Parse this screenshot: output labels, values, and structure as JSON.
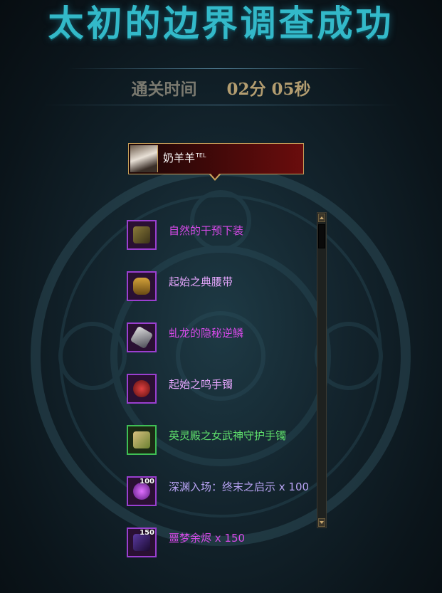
{
  "title": "太初的边界调查成功",
  "clear_time": {
    "label": "通关时间",
    "value": "02分 05秒"
  },
  "player": {
    "name": "奶羊羊",
    "tag": "TEL"
  },
  "rewards": [
    {
      "name": "自然的干预下装",
      "icon": "leg-armor-icon",
      "rarity": "purple"
    },
    {
      "name": "起始之典腰带",
      "icon": "belt-icon",
      "rarity": "purple"
    },
    {
      "name": "虬龙的隐秘逆鳞",
      "icon": "dragon-scale-icon",
      "rarity": "purple"
    },
    {
      "name": "起始之鸣手镯",
      "icon": "bracelet-icon",
      "rarity": "purple"
    },
    {
      "name": "英灵殿之女武神守护手镯",
      "icon": "valkyrie-bracelet-icon",
      "rarity": "green"
    },
    {
      "name": "深渊入场：终末之启示 x 100",
      "icon": "abyss-orb-icon",
      "rarity": "violet",
      "count": "100"
    },
    {
      "name": "噩梦余烬 x 150",
      "icon": "nightmare-ember-icon",
      "rarity": "purple",
      "count": "150"
    }
  ],
  "colors": {
    "title": "#33b9c9",
    "purple_item": "#d64ae8",
    "green_item": "#5fe06c",
    "frame_gold": "#c8a05a"
  }
}
